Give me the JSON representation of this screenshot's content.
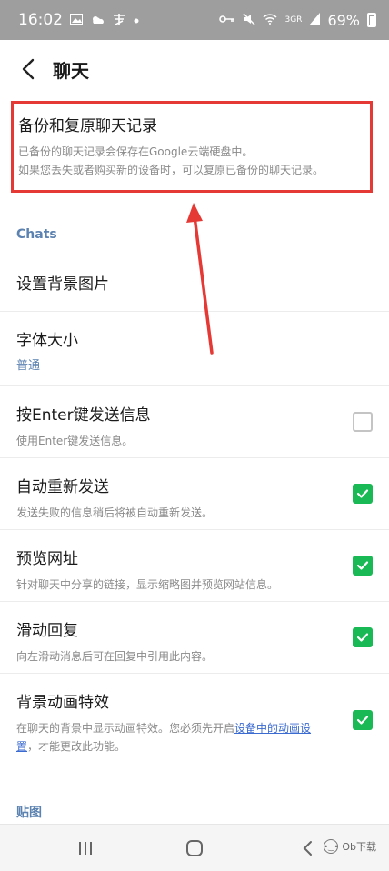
{
  "status_bar": {
    "time": "16:02",
    "left_icons": [
      "image-icon",
      "weather-icon",
      "taobao-icon",
      "dot-icon"
    ],
    "network": "3GR",
    "battery": "69%"
  },
  "header": {
    "title": "聊天"
  },
  "backup": {
    "title": "备份和复原聊天记录",
    "desc_line1": "已备份的聊天记录会保存在Google云端硬盘中。",
    "desc_line2": "如果您丢失或者购买新的设备时，可以复原已备份的聊天记录。"
  },
  "sections": {
    "chats": "Chats",
    "stickers": "贴图"
  },
  "settings": {
    "background": {
      "title": "设置背景图片"
    },
    "font_size": {
      "title": "字体大小",
      "value": "普通"
    },
    "enter_send": {
      "title": "按Enter键发送信息",
      "subtitle": "使用Enter键发送信息。",
      "checked": false
    },
    "auto_resend": {
      "title": "自动重新发送",
      "subtitle": "发送失败的信息稍后将被自动重新发送。",
      "checked": true
    },
    "url_preview": {
      "title": "预览网址",
      "subtitle": "针对聊天中分享的链接，显示缩略图并预览网站信息。",
      "checked": true
    },
    "swipe_reply": {
      "title": "滑动回复",
      "subtitle": "向左滑动消息后可在回复中引用此内容。",
      "checked": true
    },
    "bg_animation": {
      "title": "背景动画特效",
      "subtitle_prefix": "在聊天的背景中显示动画特效。您必须先开启",
      "subtitle_link": "设备中的动画设置",
      "subtitle_suffix": "，才能更改此功能。",
      "checked": true
    }
  },
  "nav": {
    "watermark": "Ob下载"
  },
  "colors": {
    "accent_blue": "#5b82b0",
    "check_green": "#19b955",
    "annotation_red": "#e53935",
    "status_bar_bg": "#9e9e9e"
  }
}
